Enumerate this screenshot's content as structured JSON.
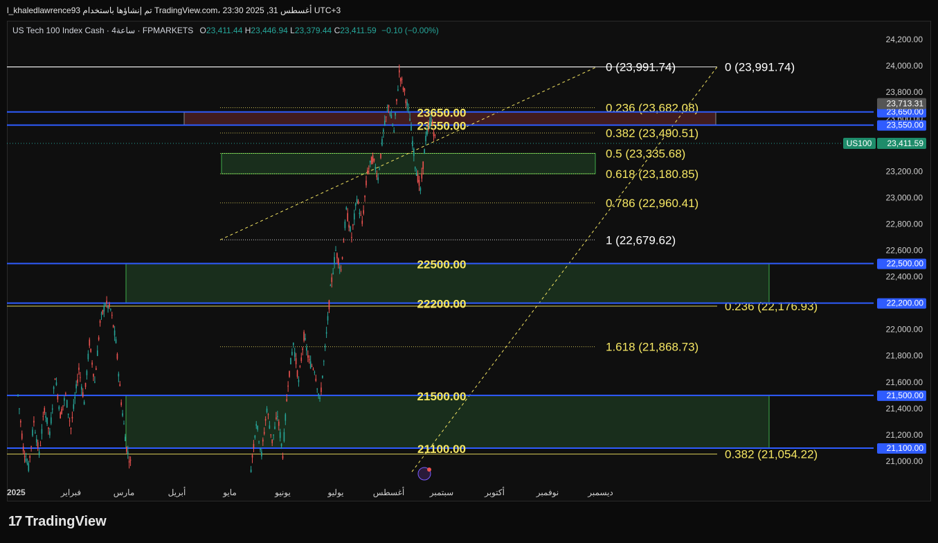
{
  "header": {
    "text": "l_khaledlawrence93 تم إنشاؤها باستخدام TradingView.com، 23:30 2025 ,31 أغسطس UTC+3"
  },
  "legend": {
    "symbol": "US Tech 100 Index Cash · 4ساعة · FPMARKETS",
    "o_label": "O",
    "o_value": "23,411.44",
    "h_label": "H",
    "h_value": "23,446.94",
    "l_label": "L",
    "l_value": "23,379.44",
    "c_label": "C",
    "c_value": "23,411.59",
    "change": "−0.10 (−0.00%)"
  },
  "colors": {
    "background": "#0f0f0f",
    "up": "#26a69a",
    "down": "#ef5350",
    "fib": "#f5e663",
    "level_line": "#2f5cff",
    "zone_green": "#1e3a22",
    "zone_red": "#4a1f22"
  },
  "footer": {
    "brand": "TradingView",
    "logo_icon": "tradingview-logo-icon"
  },
  "chart_data": {
    "type": "candlestick",
    "symbol": "US100",
    "timeframe": "4ساعة",
    "ylim": [
      20920,
      24260
    ],
    "y_ticks": [
      21000,
      21200,
      21400,
      21600,
      21800,
      22000,
      22200,
      22400,
      22600,
      22800,
      23000,
      23200,
      23400,
      23600,
      23800,
      24000,
      24200
    ],
    "y_tick_labels": [
      "21,000.00",
      "21,200.00",
      "21,400.00",
      "21,600.00",
      "21,800.00",
      "22,000.00",
      "22,200.00",
      "22,400.00",
      "22,600.00",
      "22,800.00",
      "23,000.00",
      "23,200.00",
      "23,400.00",
      "23,600.00",
      "23,800.00",
      "24,000.00",
      "24,200.00"
    ],
    "x_ticks": [
      {
        "t": 0.0,
        "label": "2025",
        "bold": true
      },
      {
        "t": 1.0,
        "label": "فبراير"
      },
      {
        "t": 2.0,
        "label": "مارس"
      },
      {
        "t": 3.0,
        "label": "أبريل"
      },
      {
        "t": 4.0,
        "label": "مايو"
      },
      {
        "t": 5.0,
        "label": "يونيو"
      },
      {
        "t": 6.0,
        "label": "يوليو"
      },
      {
        "t": 7.0,
        "label": "أغسطس"
      },
      {
        "t": 8.0,
        "label": "سبتمبر"
      },
      {
        "t": 9.0,
        "label": "أكتوبر"
      },
      {
        "t": 10.0,
        "label": "نوفمبر"
      },
      {
        "t": 11.0,
        "label": "ديسمبر"
      }
    ],
    "price_path": [
      [
        0.0,
        21500
      ],
      [
        0.1,
        21100
      ],
      [
        0.2,
        20950
      ],
      [
        0.3,
        21300
      ],
      [
        0.4,
        21050
      ],
      [
        0.5,
        21400
      ],
      [
        0.6,
        21200
      ],
      [
        0.7,
        21650
      ],
      [
        0.8,
        21350
      ],
      [
        0.9,
        21500
      ],
      [
        1.0,
        21250
      ],
      [
        1.15,
        21700
      ],
      [
        1.25,
        21450
      ],
      [
        1.35,
        21900
      ],
      [
        1.45,
        21600
      ],
      [
        1.55,
        22050
      ],
      [
        1.65,
        22200
      ],
      [
        1.75,
        22150
      ],
      [
        1.85,
        21900
      ],
      [
        1.95,
        21450
      ],
      [
        2.05,
        21100
      ],
      [
        2.15,
        20950
      ],
      [
        4.4,
        20950
      ],
      [
        4.5,
        21300
      ],
      [
        4.6,
        21050
      ],
      [
        4.7,
        21400
      ],
      [
        4.8,
        21150
      ],
      [
        4.9,
        21350
      ],
      [
        5.0,
        21050
      ],
      [
        5.1,
        21600
      ],
      [
        5.2,
        21900
      ],
      [
        5.3,
        21600
      ],
      [
        5.4,
        21950
      ],
      [
        5.5,
        21750
      ],
      [
        5.6,
        21700
      ],
      [
        5.7,
        21450
      ],
      [
        5.8,
        21850
      ],
      [
        5.9,
        22300
      ],
      [
        6.0,
        22600
      ],
      [
        6.1,
        22450
      ],
      [
        6.2,
        22900
      ],
      [
        6.3,
        22700
      ],
      [
        6.4,
        23000
      ],
      [
        6.5,
        22800
      ],
      [
        6.6,
        23200
      ],
      [
        6.7,
        23300
      ],
      [
        6.8,
        23150
      ],
      [
        6.9,
        23500
      ],
      [
        7.0,
        23700
      ],
      [
        7.1,
        23500
      ],
      [
        7.2,
        23950
      ],
      [
        7.3,
        23800
      ],
      [
        7.4,
        23600
      ],
      [
        7.5,
        23250
      ],
      [
        7.6,
        23050
      ],
      [
        7.7,
        23450
      ],
      [
        7.8,
        23600
      ],
      [
        7.9,
        23400
      ]
    ],
    "last_price": 23411.59,
    "fib_retracement": {
      "levels": [
        {
          "ratio": "0",
          "price": 23991.74,
          "label": "0 (23,991.74)",
          "color": "#ffffff"
        },
        {
          "ratio": "0.236",
          "price": 23682.08,
          "label": "0.236 (23,682.08)",
          "color": "#f5e663"
        },
        {
          "ratio": "0.382",
          "price": 23490.51,
          "label": "0.382 (23,490.51)",
          "color": "#f5e663"
        },
        {
          "ratio": "0.5",
          "price": 23335.68,
          "label": "0.5 (23,335.68)",
          "color": "#f5e663"
        },
        {
          "ratio": "0.618",
          "price": 23180.85,
          "label": "0.618 (23,180.85)",
          "color": "#f5e663"
        },
        {
          "ratio": "0.786",
          "price": 22960.41,
          "label": "0.786 (22,960.41)",
          "color": "#f5e663"
        },
        {
          "ratio": "1",
          "price": 22679.62,
          "label": "1 (22,679.62)",
          "color": "#ffffff"
        },
        {
          "ratio": "1.618",
          "price": 21868.73,
          "label": "1.618 (21,868.73)",
          "color": "#f5e663"
        }
      ]
    },
    "fib_extension": {
      "levels": [
        {
          "ratio": "0",
          "price": 23991.74,
          "label": "0 (23,991.74)",
          "color": "#ffffff"
        },
        {
          "ratio": "0.236",
          "price": 22176.93,
          "label": "0.236 (22,176.93)",
          "color": "#f5e663"
        },
        {
          "ratio": "0.382",
          "price": 21054.22,
          "label": "0.382 (21,054.22)",
          "color": "#f5e663"
        }
      ]
    },
    "horizontal_levels": [
      {
        "price": 23650,
        "label": "23650.00",
        "axis_label": "23,650.00"
      },
      {
        "price": 23550,
        "label": "23550.00",
        "axis_label": "23,550.00"
      },
      {
        "price": 22500,
        "label": "22500.00",
        "axis_label": "22,500.00"
      },
      {
        "price": 22200,
        "label": "22200.00",
        "axis_label": "22,200.00"
      },
      {
        "price": 21500,
        "label": "21500.00",
        "axis_label": "21,500.00"
      },
      {
        "price": 21100,
        "label": "21100.00",
        "axis_label": "21,100.00"
      }
    ],
    "zones": [
      {
        "top": 23650,
        "bottom": 23550,
        "kind": "supply"
      },
      {
        "top": 23335.68,
        "bottom": 23180.85,
        "kind": "demand"
      },
      {
        "top": 22500,
        "bottom": 22200,
        "kind": "demand"
      },
      {
        "top": 21500,
        "bottom": 21100,
        "kind": "demand"
      }
    ],
    "axis_badges": [
      {
        "price": 23713.31,
        "label": "23,713.31",
        "kind": "gray"
      },
      {
        "price": 23411.59,
        "label": "23,411.59",
        "kind": "green",
        "tag": "US100"
      }
    ]
  }
}
